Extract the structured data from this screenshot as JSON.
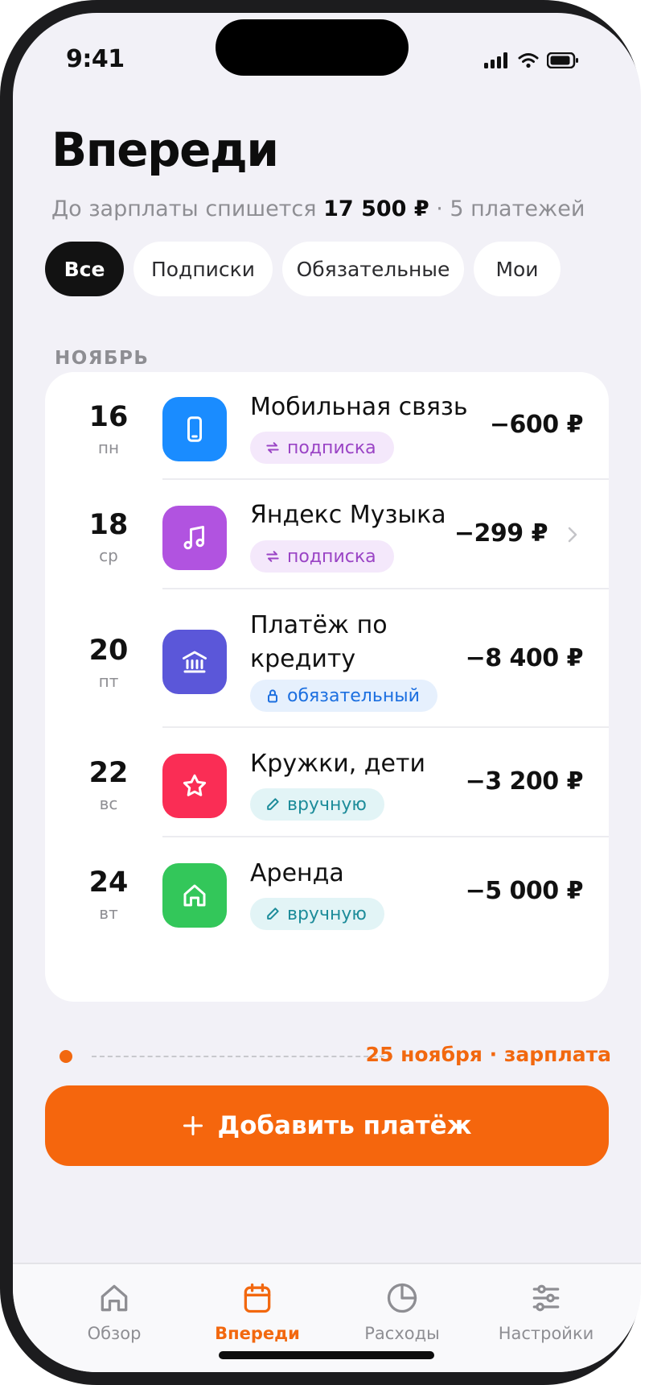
{
  "status": {
    "time": "9:41"
  },
  "header": {
    "title": "Впереди",
    "subtitle_prefix": "До зарплаты спишется ",
    "subtitle_amount": "17 500 ₽",
    "subtitle_suffix": " · 5 платежей"
  },
  "filters": [
    {
      "label": "Все",
      "active": true
    },
    {
      "label": "Подписки",
      "active": false
    },
    {
      "label": "Обязательные",
      "active": false
    },
    {
      "label": "Мои",
      "active": false
    }
  ],
  "month": "НОЯБРЬ",
  "payments": [
    {
      "day": "16",
      "weekday": "пн",
      "name": "Мобильная связь",
      "tag": "подписка",
      "tag_type": "subscription",
      "amount": "−600 ₽",
      "icon": "phone-icon",
      "color": "#1a8cff"
    },
    {
      "day": "18",
      "weekday": "ср",
      "name": "Яндекс Музыка",
      "tag": "подписка",
      "tag_type": "subscription",
      "amount": "−299 ₽",
      "icon": "music-note-icon",
      "color": "#b153e0"
    },
    {
      "day": "20",
      "weekday": "пт",
      "name_line1": "Платёж по",
      "name_line2": "кредиту",
      "tag": "обязательный",
      "tag_type": "mandatory",
      "amount": "−8 400 ₽",
      "icon": "bank-icon",
      "color": "#5b57d9"
    },
    {
      "day": "22",
      "weekday": "вс",
      "name": "Кружки, дети",
      "tag": "вручную",
      "tag_type": "manual",
      "amount": "−3 200 ₽",
      "icon": "star-icon",
      "color": "#fa2d55"
    },
    {
      "day": "24",
      "weekday": "вт",
      "name": "Аренда",
      "tag": "вручную",
      "tag_type": "manual",
      "amount": "−5 000 ₽",
      "icon": "home-icon",
      "color": "#33c75a"
    }
  ],
  "salary_marker": "25 ноября · зарплата",
  "add_button": {
    "label": "Добавить платёж"
  },
  "tabs": [
    {
      "label": "Обзор",
      "icon": "home-outline-icon",
      "active": false
    },
    {
      "label": "Впереди",
      "icon": "calendar-icon",
      "active": true
    },
    {
      "label": "Расходы",
      "icon": "pie-chart-icon",
      "active": false
    },
    {
      "label": "Настройки",
      "icon": "sliders-icon",
      "active": false
    }
  ],
  "colors": {
    "accent": "#f5660d",
    "subscription": "#9a44c5",
    "mandatory": "#1c6fe0",
    "manual": "#1d8c9a"
  }
}
